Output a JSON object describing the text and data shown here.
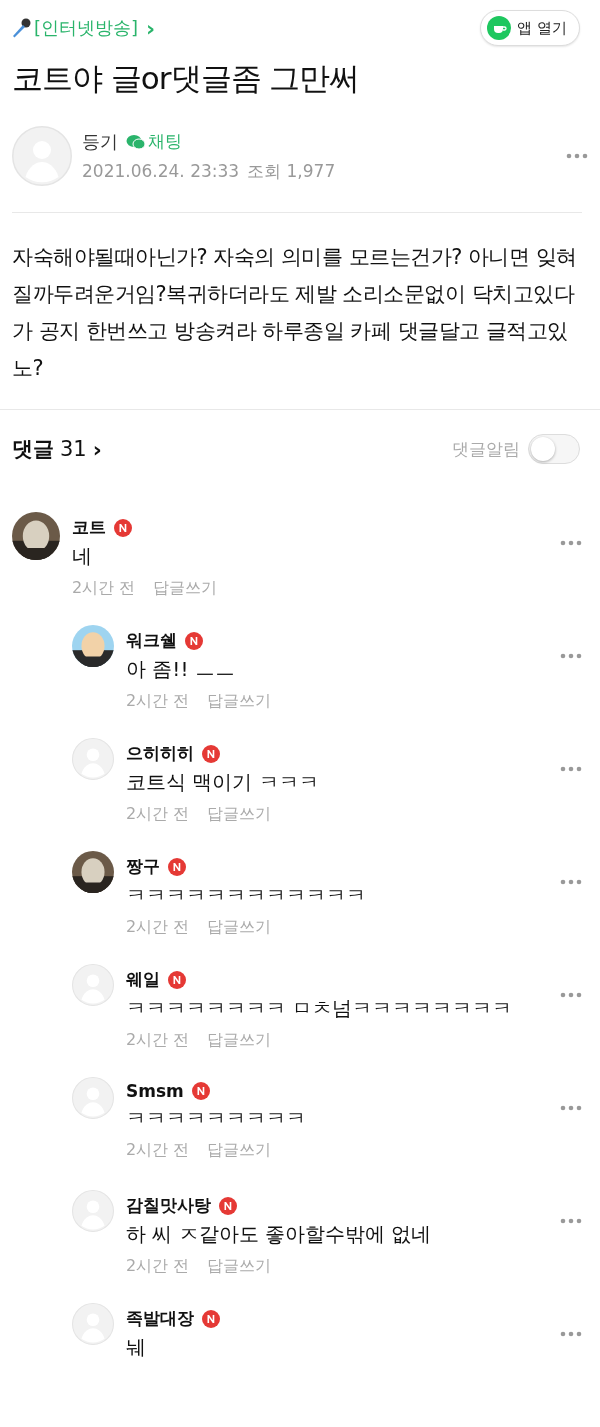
{
  "header": {
    "category": "[인터넷방송]",
    "chevron": "›",
    "open_app": "앱 열기"
  },
  "title": "코트야 글or댓글좀 그만써",
  "author": {
    "name": "등기",
    "chat": "채팅",
    "date": "2021.06.24. 23:33",
    "views": "조회 1,977",
    "avatar": {
      "kind": "default"
    }
  },
  "body": "자숙해야될때아닌가? 자숙의 의미를 모르는건가? 아니면 잊혀질까두려운거임?복귀하더라도 제발 소리소문없이 닥치고있다가 공지 한번쓰고 방송켜라 하루종일 카페 댓글달고 글적고있노?",
  "comments_header": {
    "label": "댓글",
    "count": "31",
    "chevron": "›",
    "alert_label": "댓글알림",
    "alert_on": false
  },
  "comments": [
    {
      "name": "코트",
      "reply": false,
      "text": "네",
      "time": "2시간 전",
      "action": "답글쓰기"
    },
    {
      "name": "워크쉘",
      "reply": true,
      "text": "아 좀!! ㅡㅡ",
      "time": "2시간 전",
      "action": "답글쓰기"
    },
    {
      "name": "으히히히",
      "reply": true,
      "avatar": {
        "kind": "default"
      },
      "text": "코트식 맥이기 ㅋㅋㅋ",
      "time": "2시간 전",
      "action": "답글쓰기"
    },
    {
      "name": "짱구",
      "reply": true,
      "text": "ㅋㅋㅋㅋㅋㅋㅋㅋㅋㅋㅋㅋ",
      "time": "2시간 전",
      "action": "답글쓰기"
    },
    {
      "name": "웨일",
      "reply": true,
      "avatar": {
        "kind": "default"
      },
      "text": "ㅋㅋㅋㅋㅋㅋㅋㅋ ㅁㅊ넘ㅋㅋㅋㅋㅋㅋㅋㅋ",
      "time": "2시간 전",
      "action": "답글쓰기"
    },
    {
      "name": "Smsm",
      "reply": true,
      "avatar": {
        "kind": "default"
      },
      "text": "ㅋㅋㅋㅋㅋㅋㅋㅋㅋ",
      "time": "2시간 전",
      "action": "답글쓰기"
    },
    {
      "name": "감칠맛사탕",
      "reply": true,
      "avatar": {
        "kind": "default"
      },
      "text": "하 씨 ㅈ같아도 좋아할수밖에 없네",
      "time": "2시간 전",
      "action": "답글쓰기"
    },
    {
      "name": "족발대장",
      "reply": true,
      "avatar": {
        "kind": "default"
      },
      "text": "눼"
    }
  ]
}
